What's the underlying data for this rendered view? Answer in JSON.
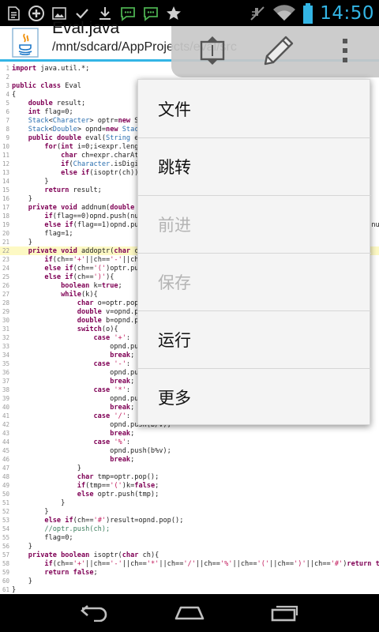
{
  "status_bar": {
    "time": "14:50",
    "icons": [
      "document-icon",
      "add-circle-icon",
      "image-icon",
      "check-icon",
      "download-icon",
      "chat-icon",
      "chat-icon",
      "star-icon"
    ],
    "accent": "#33b5e5"
  },
  "header": {
    "file_name": "Eval.java",
    "path": "/mnt/sdcard/AppProjects/eval/src"
  },
  "toolbar": {
    "buttons": [
      "swap-screen-icon",
      "pencil-icon",
      "overflow-menu-icon"
    ]
  },
  "menu": {
    "items": [
      {
        "label": "文件",
        "enabled": true
      },
      {
        "label": "跳转",
        "enabled": true
      },
      {
        "label": "前进",
        "enabled": false
      },
      {
        "label": "保存",
        "enabled": false
      },
      {
        "label": "运行",
        "enabled": true
      },
      {
        "label": "更多",
        "enabled": true
      }
    ]
  },
  "editor": {
    "highlighted_line": 22,
    "lines": [
      "import java.util.*;",
      "",
      "public class Eval",
      "{",
      "    double result;",
      "    int flag=0;",
      "    Stack<Character> optr=new St",
      "    Stack<Double> opnd=new Stack",
      "    public double eval(String ex",
      "        for(int i=0;i<expr.lengt",
      "            char ch=expr.charAt(",
      "            if(Character.isDigit",
      "            else if(isoptr(ch))a",
      "        }",
      "        return result;",
      "    }",
      "    private void addnum(double n",
      "        if(flag==0)opnd.push(num",
      "        else if(flag==1)opnd.pus                                                        nu",
      "        flag=1;",
      "    }",
      "    private void addoptr(char ch",
      "        if(ch=='+'||ch=='-'||ch=",
      "        else if(ch=='(')optr.pus",
      "        else if(ch==')'){",
      "            boolean k=true;",
      "            while(k){",
      "                char o=optr.pop(",
      "                double v=opnd.po",
      "                double b=opnd.po",
      "                switch(o){",
      "                    case '+':",
      "                        opnd.pus",
      "                        break;",
      "                    case '-':",
      "                        opnd.pus",
      "                        break;",
      "                    case '*':",
      "                        opnd.pus",
      "                        break;",
      "                    case '/':",
      "                        opnd.push(b/v);",
      "                        break;",
      "                    case '%':",
      "                        opnd.push(b%v);",
      "                        break;",
      "                }",
      "                char tmp=optr.pop();",
      "                if(tmp=='(')k=false;",
      "                else optr.push(tmp);",
      "            }",
      "        }",
      "        else if(ch=='#')result=opnd.pop();",
      "        //optr.push(ch);",
      "        flag=0;",
      "    }",
      "    private boolean isoptr(char ch){",
      "        if(ch=='+'||ch=='-'||ch=='*'||ch=='/'||ch=='%'||ch=='('||ch==')'||ch=='#')return true",
      "        return false;",
      "    }",
      "}"
    ]
  },
  "nav_bar": {
    "buttons": [
      "back-icon",
      "home-icon",
      "recent-apps-icon"
    ]
  }
}
